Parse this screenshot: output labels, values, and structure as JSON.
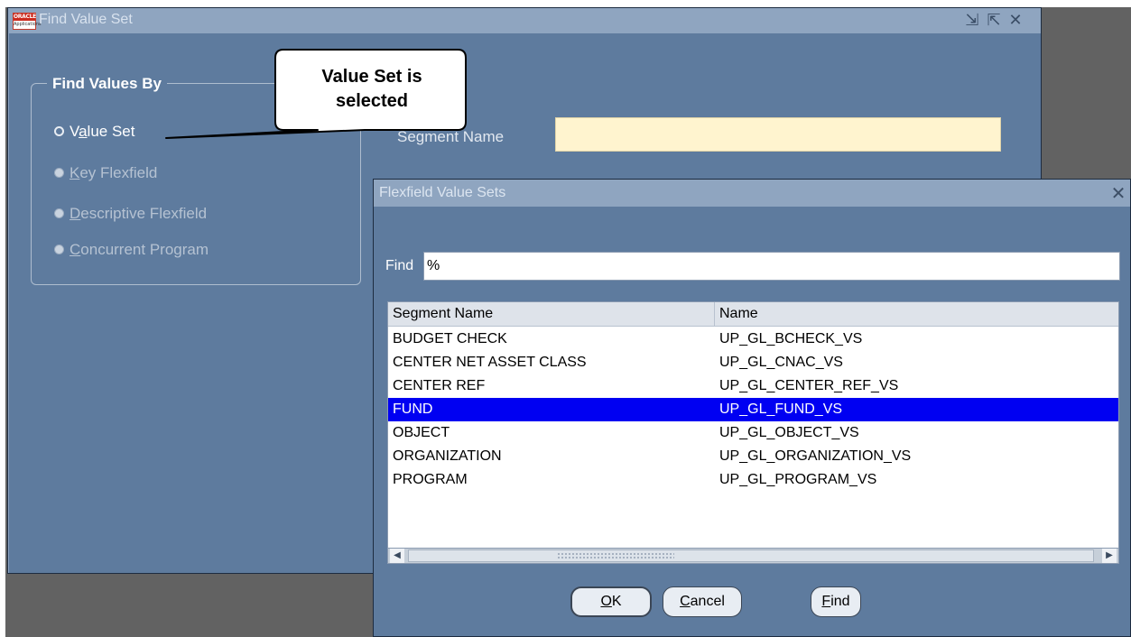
{
  "main_window": {
    "title": "Find Value Set",
    "logo_top": "ORACLE",
    "logo_bottom": "Applications",
    "title_buttons": [
      "minimize-icon",
      "maximize-icon",
      "close-icon"
    ]
  },
  "find_values_by": {
    "title": "Find Values By",
    "options": [
      {
        "pre": "V",
        "accel": "a",
        "post": "lue Set",
        "selected": true,
        "enabled": true
      },
      {
        "pre": "",
        "accel": "K",
        "post": "ey Flexfield",
        "selected": false,
        "enabled": false
      },
      {
        "pre": "",
        "accel": "D",
        "post": "escriptive Flexfield",
        "selected": false,
        "enabled": false
      },
      {
        "pre": "",
        "accel": "C",
        "post": "oncurrent Program",
        "selected": false,
        "enabled": false
      }
    ]
  },
  "segment_name": {
    "label": "Segment Name",
    "value": ""
  },
  "callout": {
    "line1": "Value Set is",
    "line2": "selected"
  },
  "dialog": {
    "title": "Flexfield Value Sets",
    "find_label": "Find",
    "find_value": "%",
    "columns": [
      "Segment Name",
      "Name"
    ],
    "rows": [
      {
        "segment": "BUDGET CHECK",
        "name": "UP_GL_BCHECK_VS",
        "selected": false
      },
      {
        "segment": "CENTER NET ASSET CLASS",
        "name": "UP_GL_CNAC_VS",
        "selected": false
      },
      {
        "segment": "CENTER REF",
        "name": "UP_GL_CENTER_REF_VS",
        "selected": false
      },
      {
        "segment": "FUND",
        "name": "UP_GL_FUND_VS",
        "selected": true
      },
      {
        "segment": "OBJECT",
        "name": "UP_GL_OBJECT_VS",
        "selected": false
      },
      {
        "segment": "ORGANIZATION",
        "name": "UP_GL_ORGANIZATION_VS",
        "selected": false
      },
      {
        "segment": "PROGRAM",
        "name": "UP_GL_PROGRAM_VS",
        "selected": false
      }
    ],
    "buttons": {
      "ok": {
        "accel": "O",
        "post": "K"
      },
      "cancel": {
        "accel": "C",
        "post": "ancel"
      },
      "find": {
        "accel": "F",
        "post": "ind"
      }
    }
  },
  "colors": {
    "window_bg": "#5e7b9e",
    "titlebar": "#8fa5c0",
    "selection": "#0000f2",
    "field_yellow": "#fff4cf",
    "disabled_text": "#b5c2d2"
  }
}
